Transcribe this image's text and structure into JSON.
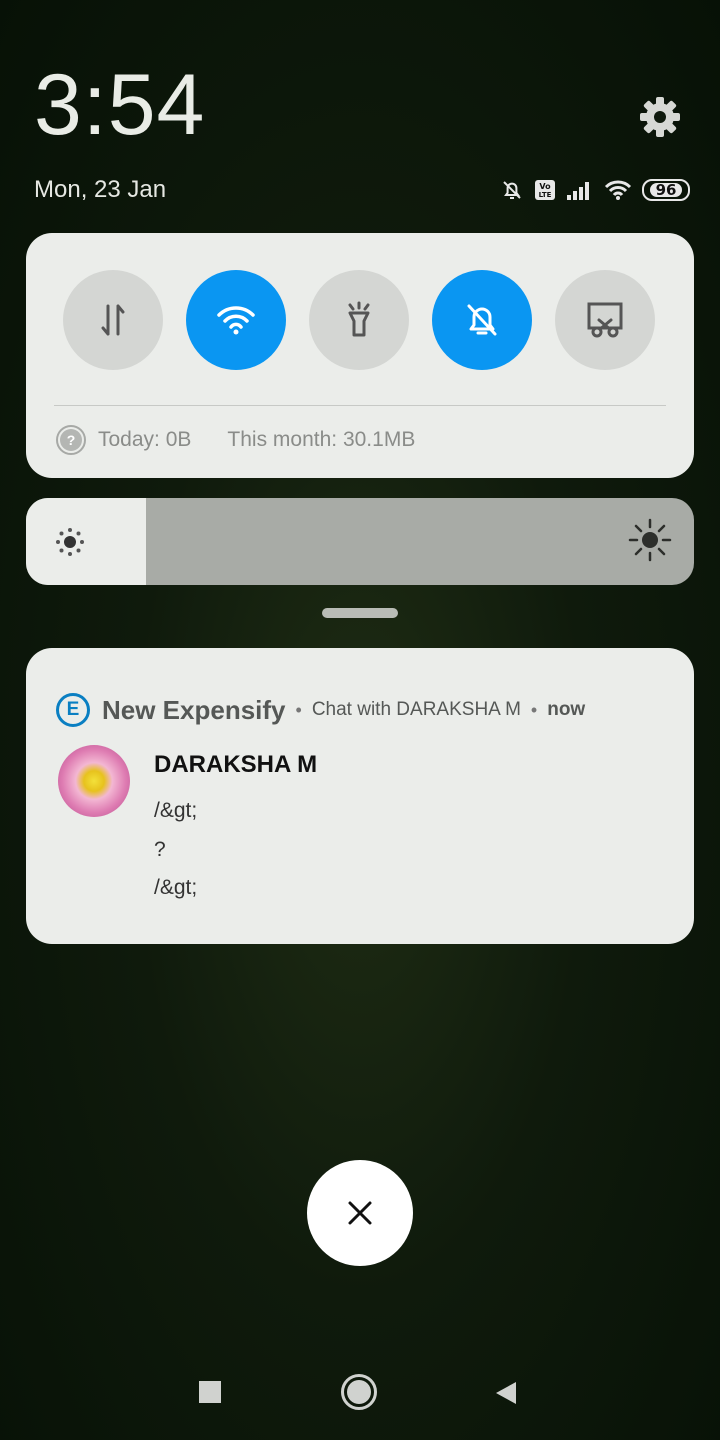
{
  "header": {
    "time": "3:54",
    "date": "Mon, 23 Jan",
    "battery": "96",
    "status_icons": [
      "bell-off-icon",
      "volte-icon",
      "signal-icon",
      "wifi-icon",
      "battery-icon"
    ]
  },
  "quick_settings": {
    "tiles": [
      {
        "name": "mobile-data",
        "icon": "data-transfer-icon",
        "active": false
      },
      {
        "name": "wifi",
        "icon": "wifi-icon",
        "active": true
      },
      {
        "name": "flashlight",
        "icon": "flashlight-icon",
        "active": false
      },
      {
        "name": "mute",
        "icon": "bell-off-icon",
        "active": true
      },
      {
        "name": "screenshot",
        "icon": "scissors-icon",
        "active": false
      }
    ],
    "today": "Today: 0B",
    "month": "This month: 30.1MB",
    "accent": "#0a96f2"
  },
  "brightness": {
    "level": 0.18
  },
  "notification": {
    "app": "New Expensify",
    "app_initial": "E",
    "subtitle": "Chat with DARAKSHA M",
    "time": "now",
    "sender": "DARAKSHA M",
    "lines": [
      "/&gt;",
      "?",
      "/&gt;"
    ]
  }
}
